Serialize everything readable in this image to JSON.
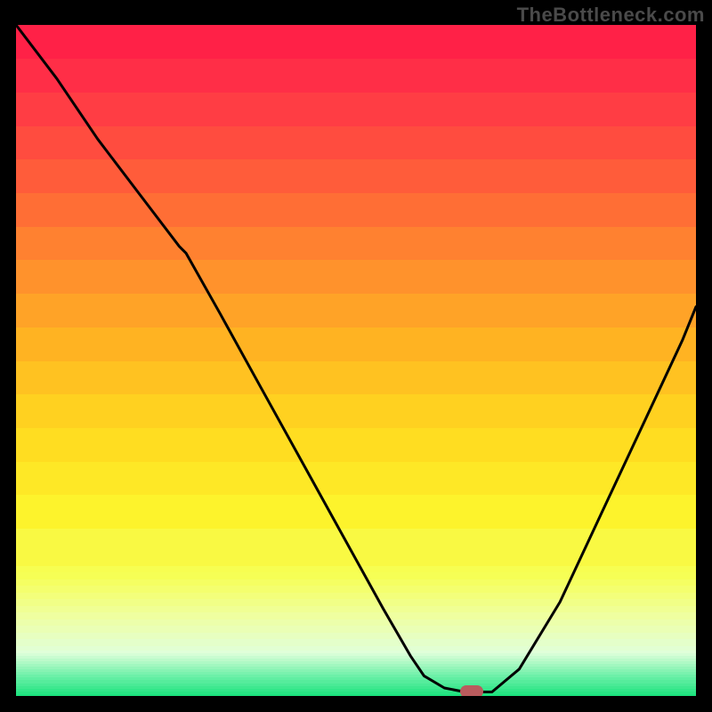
{
  "watermark": "TheBottleneck.com",
  "colors": {
    "background": "#000000",
    "curve": "#000000",
    "marker": "#b95b5d",
    "gradient_stops": [
      {
        "pos": 0.0,
        "color": "#ff1a47"
      },
      {
        "pos": 0.1,
        "color": "#ff3547"
      },
      {
        "pos": 0.22,
        "color": "#ff5a3a"
      },
      {
        "pos": 0.35,
        "color": "#ff8a2e"
      },
      {
        "pos": 0.48,
        "color": "#ffb522"
      },
      {
        "pos": 0.6,
        "color": "#ffd81f"
      },
      {
        "pos": 0.72,
        "color": "#fdf22a"
      },
      {
        "pos": 0.82,
        "color": "#f6ff55"
      },
      {
        "pos": 0.88,
        "color": "#efffa0"
      },
      {
        "pos": 0.935,
        "color": "#e0ffda"
      },
      {
        "pos": 0.97,
        "color": "#6df0a8"
      },
      {
        "pos": 1.0,
        "color": "#15e17a"
      }
    ]
  },
  "chart_data": {
    "type": "line",
    "title": "",
    "xlabel": "",
    "ylabel": "",
    "xlim": [
      0,
      100
    ],
    "ylim": [
      0,
      100
    ],
    "grid": false,
    "x": [
      0,
      6,
      12,
      18,
      24,
      25,
      30,
      36,
      42,
      48,
      54,
      58,
      60,
      63,
      66,
      70,
      74,
      80,
      86,
      92,
      98,
      100
    ],
    "y": [
      100,
      92,
      83,
      75,
      67,
      66,
      57,
      46,
      35,
      24,
      13,
      6,
      3,
      1.2,
      0.6,
      0.6,
      4,
      14,
      27,
      40,
      53,
      58
    ],
    "optimum": {
      "x": 67,
      "y": 0.6
    },
    "series": [
      {
        "name": "bottleneck-curve",
        "x_ref": "x",
        "y_ref": "y"
      }
    ]
  }
}
